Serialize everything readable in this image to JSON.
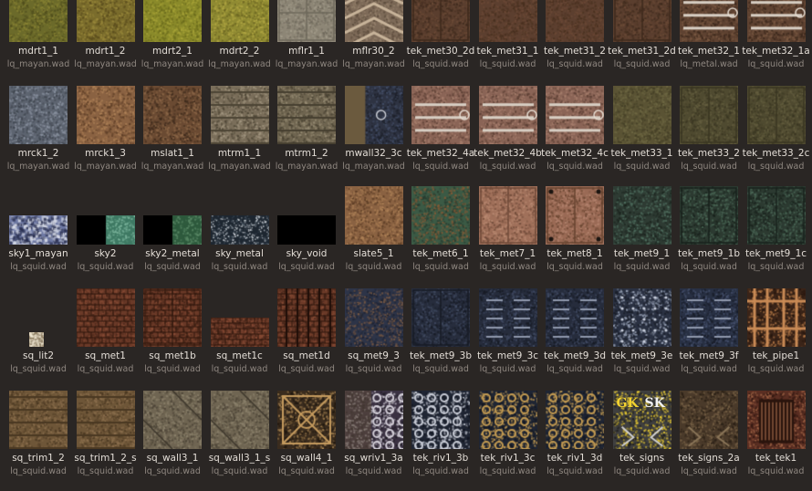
{
  "browser": {
    "textures": [
      {
        "name": "mdrt1_1",
        "wad": "lq_mayan.wad",
        "pattern": "grass-olive"
      },
      {
        "name": "mdrt1_2",
        "wad": "lq_mayan.wad",
        "pattern": "grass-olive2"
      },
      {
        "name": "mdrt2_1",
        "wad": "lq_mayan.wad",
        "pattern": "grass-yellow"
      },
      {
        "name": "mdrt2_2",
        "wad": "lq_mayan.wad",
        "pattern": "grass-yellow2"
      },
      {
        "name": "mflr1_1",
        "wad": "lq_mayan.wad",
        "pattern": "tile-grid"
      },
      {
        "name": "mflr30_2",
        "wad": "lq_mayan.wad",
        "pattern": "chevron"
      },
      {
        "name": "tek_met30_2d",
        "wad": "lq_squid.wad",
        "pattern": "metal-brown-panels"
      },
      {
        "name": "tek_met31_1",
        "wad": "lq_squid.wad",
        "pattern": "metal-brown"
      },
      {
        "name": "tek_met31_2",
        "wad": "lq_squid.wad",
        "pattern": "metal-brown"
      },
      {
        "name": "tek_met31_2d",
        "wad": "lq_squid.wad",
        "pattern": "metal-brown-panels"
      },
      {
        "name": "tek_met32_1",
        "wad": "lq_metal.wad",
        "pattern": "metal-pipe"
      },
      {
        "name": "tek_met32_1a",
        "wad": "lq_squid.wad",
        "pattern": "metal-pipe"
      },
      {
        "name": "mrck1_2",
        "wad": "lq_mayan.wad",
        "pattern": "rock-grey"
      },
      {
        "name": "mrck1_3",
        "wad": "lq_mayan.wad",
        "pattern": "rock-brown"
      },
      {
        "name": "mslat1_1",
        "wad": "lq_mayan.wad",
        "pattern": "rock-dark"
      },
      {
        "name": "mtrm1_1",
        "wad": "lq_mayan.wad",
        "pattern": "trim-bands"
      },
      {
        "name": "mtrm1_2",
        "wad": "lq_mayan.wad",
        "pattern": "trim-bands2"
      },
      {
        "name": "mwall32_3c",
        "wad": "lq_mayan.wad",
        "pattern": "wall-rivet"
      },
      {
        "name": "tek_met32_4a",
        "wad": "lq_squid.wad",
        "pattern": "metal-pipe-panel"
      },
      {
        "name": "tek_met32_4b",
        "wad": "lq_squid.wad",
        "pattern": "metal-pipe-panel"
      },
      {
        "name": "tek_met32_4c",
        "wad": "lq_squid.wad",
        "pattern": "metal-pipe-panel"
      },
      {
        "name": "tek_met33_1",
        "wad": "lq_squid.wad",
        "pattern": "metal-olive"
      },
      {
        "name": "tek_met33_2",
        "wad": "lq_squid.wad",
        "pattern": "metal-olive-panels"
      },
      {
        "name": "tek_met33_2c",
        "wad": "lq_squid.wad",
        "pattern": "metal-olive-panels"
      },
      {
        "name": "sky1_mayan",
        "wad": "lq_squid.wad",
        "pattern": "sky-clouds"
      },
      {
        "name": "sky2",
        "wad": "lq_squid.wad",
        "pattern": "sky-half"
      },
      {
        "name": "sky2_metal",
        "wad": "lq_squid.wad",
        "pattern": "sky-half-green"
      },
      {
        "name": "sky_metal",
        "wad": "lq_squid.wad",
        "pattern": "sky-stars"
      },
      {
        "name": "sky_void",
        "wad": "lq_squid.wad",
        "pattern": "sky-void"
      },
      {
        "name": "slate5_1",
        "wad": "lq_squid.wad",
        "pattern": "rock-brown"
      },
      {
        "name": "tek_met6_1",
        "wad": "lq_squid.wad",
        "pattern": "metal-rust-green"
      },
      {
        "name": "tek_met7_1",
        "wad": "lq_squid.wad",
        "pattern": "metal-plate"
      },
      {
        "name": "tek_met8_1",
        "wad": "lq_squid.wad",
        "pattern": "metal-plate-bolts"
      },
      {
        "name": "tek_met9_1",
        "wad": "lq_squid.wad",
        "pattern": "metal-green-speck"
      },
      {
        "name": "tek_met9_1b",
        "wad": "lq_squid.wad",
        "pattern": "metal-green-panels"
      },
      {
        "name": "tek_met9_1c",
        "wad": "lq_squid.wad",
        "pattern": "metal-green-panels"
      },
      {
        "name": "sq_lit2",
        "wad": "lq_squid.wad",
        "pattern": "light-small"
      },
      {
        "name": "sq_met1",
        "wad": "lq_squid.wad",
        "pattern": "brick-rust"
      },
      {
        "name": "sq_met1b",
        "wad": "lq_squid.wad",
        "pattern": "brick-rust-panels"
      },
      {
        "name": "sq_met1c",
        "wad": "lq_squid.wad",
        "pattern": "brick-rust-half"
      },
      {
        "name": "sq_met1d",
        "wad": "lq_squid.wad",
        "pattern": "brick-rust-strips"
      },
      {
        "name": "sq_met9_3",
        "wad": "lq_squid.wad",
        "pattern": "metal-blue-mix"
      },
      {
        "name": "tek_met9_3b",
        "wad": "lq_squid.wad",
        "pattern": "metal-blue-panels"
      },
      {
        "name": "tek_met9_3c",
        "wad": "lq_squid.wad",
        "pattern": "metal-blue-vents"
      },
      {
        "name": "tek_met9_3d",
        "wad": "lq_squid.wad",
        "pattern": "metal-blue-vents"
      },
      {
        "name": "tek_met9_3e",
        "wad": "lq_squid.wad",
        "pattern": "metal-blue-dots"
      },
      {
        "name": "tek_met9_3f",
        "wad": "lq_squid.wad",
        "pattern": "metal-blue-slots"
      },
      {
        "name": "tek_pipe1",
        "wad": "lq_squid.wad",
        "pattern": "pipes-copper"
      },
      {
        "name": "sq_trim1_2",
        "wad": "lq_squid.wad",
        "pattern": "trim-rust"
      },
      {
        "name": "sq_trim1_2_s",
        "wad": "lq_squid.wad",
        "pattern": "trim-rust"
      },
      {
        "name": "sq_wall3_1",
        "wad": "lq_squid.wad",
        "pattern": "wall-diamond"
      },
      {
        "name": "sq_wall3_1_s",
        "wad": "lq_squid.wad",
        "pattern": "wall-diamond"
      },
      {
        "name": "sq_wall4_1",
        "wad": "lq_squid.wad",
        "pattern": "wall-ornate"
      },
      {
        "name": "sq_wriv1_3a",
        "wad": "lq_squid.wad",
        "pattern": "rivet-mix"
      },
      {
        "name": "tek_riv1_3b",
        "wad": "lq_squid.wad",
        "pattern": "rivet-rings"
      },
      {
        "name": "tek_riv1_3c",
        "wad": "lq_squid.wad",
        "pattern": "rivet-rings-gold"
      },
      {
        "name": "tek_riv1_3d",
        "wad": "lq_squid.wad",
        "pattern": "rivet-rings-gold"
      },
      {
        "name": "tek_signs",
        "wad": "lq_squid.wad",
        "pattern": "signs",
        "sign_text": [
          "GK",
          "SK"
        ]
      },
      {
        "name": "tek_signs_2a",
        "wad": "lq_squid.wad",
        "pattern": "signs-arrows"
      },
      {
        "name": "tek_tek1",
        "wad": "lq_squid.wad",
        "pattern": "tek-door"
      }
    ]
  },
  "colors": {
    "background": "#2a2624",
    "label": "#e3ddd6",
    "wad_label": "#8f8780"
  }
}
